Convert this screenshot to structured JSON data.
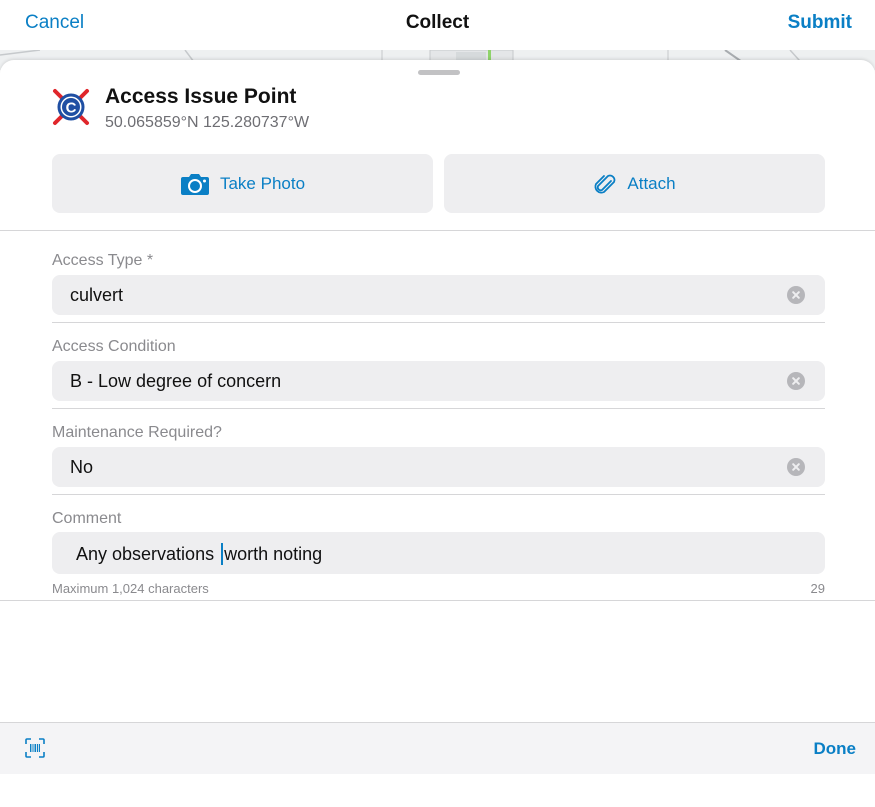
{
  "nav": {
    "cancel_label": "Cancel",
    "title": "Collect",
    "submit_label": "Submit"
  },
  "feature": {
    "title": "Access Issue Point",
    "coordinates": "50.065859°N  125.280737°W",
    "logo_icon": "c-logo-icon"
  },
  "actions": {
    "photo_label": "Take Photo",
    "photo_icon": "camera-icon",
    "attach_label": "Attach",
    "attach_icon": "paperclip-icon"
  },
  "fields": [
    {
      "label": "Access Type *",
      "value": "culvert"
    },
    {
      "label": "Access Condition",
      "value": "B - Low degree of concern"
    },
    {
      "label": "Maintenance Required?",
      "value": "No"
    }
  ],
  "comment": {
    "label": "Comment",
    "text_before_cursor": "Any observations ",
    "text_after_cursor": "worth noting",
    "help": "Maximum 1,024 characters",
    "count": "29"
  },
  "toolbar": {
    "scan_icon": "barcode-scan-icon",
    "done_label": "Done"
  },
  "colors": {
    "accent": "#0a7fc5",
    "field_bg": "#eeeef0",
    "logo_blue": "#1f4fa3",
    "logo_red": "#e0262b"
  }
}
